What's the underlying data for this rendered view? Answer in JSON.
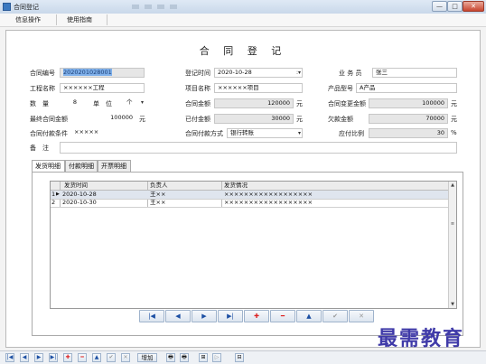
{
  "window": {
    "title": "合同登记",
    "controls": {
      "minimize": "—",
      "maximize": "□",
      "close": "✕"
    }
  },
  "menu": {
    "items": [
      "信息操作",
      "使用指南"
    ]
  },
  "form": {
    "heading": "合 同 登 记",
    "contract_no": {
      "label": "合同编号",
      "value": "2020201028001"
    },
    "register_time": {
      "label": "登记时间",
      "value": "2020-10-28"
    },
    "clerk": {
      "label": "业 务 员",
      "value": "张三"
    },
    "project_name_left": {
      "label": "工程名称",
      "value": "××××××工程"
    },
    "project_name": {
      "label": "项目名称",
      "value": "××××××项目"
    },
    "product_model": {
      "label": "产品型号",
      "value": "A产品"
    },
    "quantity": {
      "label": "数　量",
      "value": "8"
    },
    "unit": {
      "label": "单　位",
      "value": "个"
    },
    "contract_amount": {
      "label": "合同金额",
      "value": "120000",
      "unit": "元"
    },
    "changed_amount": {
      "label": "合同变更金额",
      "value": "100000",
      "unit": "元"
    },
    "final_amount": {
      "label": "最终合同金额",
      "value": "100000",
      "unit": "元"
    },
    "paid_amount": {
      "label": "已付金额",
      "value": "30000",
      "unit": "元"
    },
    "owed_amount": {
      "label": "欠款金额",
      "value": "70000",
      "unit": "元"
    },
    "payment_terms": {
      "label": "合同付款条件",
      "value": "×××××"
    },
    "payment_method": {
      "label": "合同付款方式",
      "value": "银行转账"
    },
    "payable_ratio": {
      "label": "应付比例",
      "value": "30",
      "unit": "%"
    },
    "remarks": {
      "label": "备　注",
      "value": ""
    }
  },
  "tabs": [
    "发货明细",
    "付款明细",
    "开票明细"
  ],
  "grid": {
    "columns": [
      "发货时间",
      "负责人",
      "发货情况"
    ],
    "rows": [
      {
        "no": "1",
        "time": "2020-10-28",
        "owner": "王××",
        "status": "××××××××××××××××××"
      },
      {
        "no": "2",
        "time": "2020-10-30",
        "owner": "王××",
        "status": "××××××××××××××××××"
      }
    ]
  },
  "nav_buttons": [
    "|◀",
    "◀",
    "▶",
    "▶|",
    "✚",
    "━",
    "▲",
    "✔",
    "✕"
  ],
  "status_bar": {
    "buttons": [
      "|◀",
      "◀",
      "▶",
      "▶|",
      "✚",
      "━",
      "▲",
      "✔",
      "✕"
    ],
    "add_label": "增加",
    "extra_icons": [
      "🖶",
      "🖶",
      "⊞",
      "▷",
      "⊟"
    ]
  },
  "watermark": "最需教育"
}
